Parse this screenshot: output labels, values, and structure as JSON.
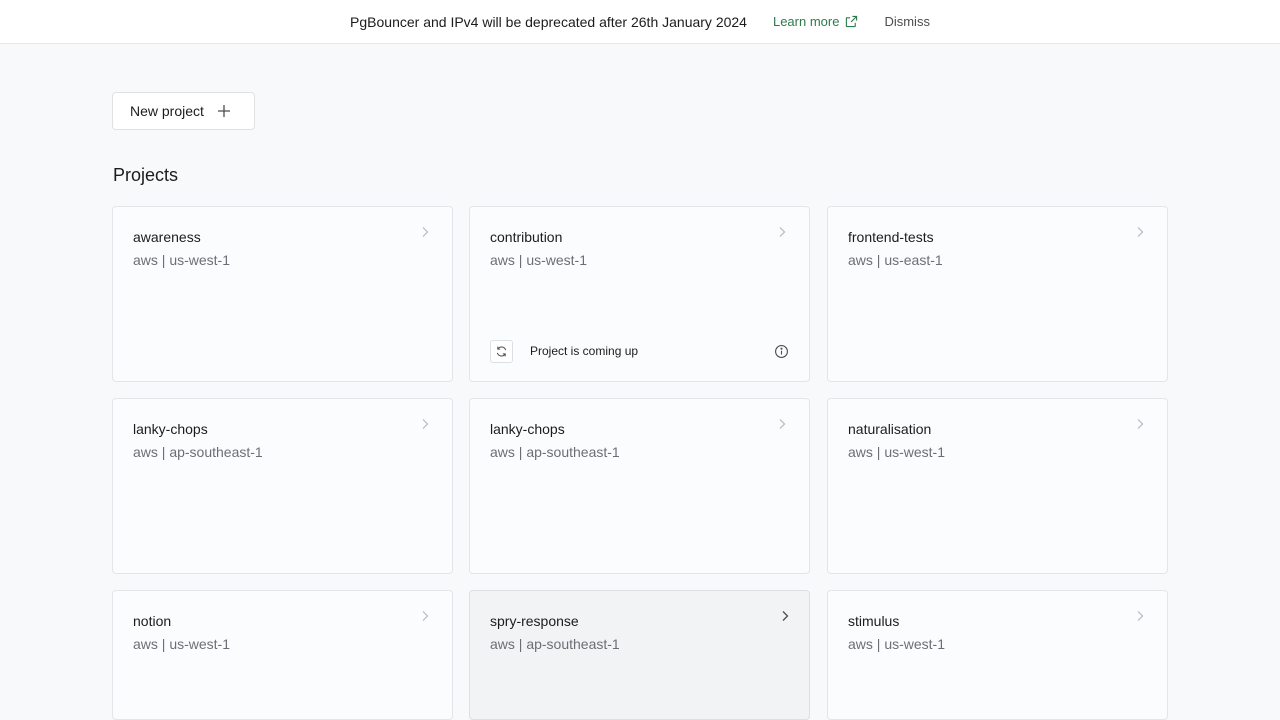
{
  "banner": {
    "message": "PgBouncer and IPv4 will be deprecated after 26th January 2024",
    "learn_more": "Learn more",
    "dismiss": "Dismiss"
  },
  "toolbar": {
    "new_project_label": "New project"
  },
  "projects": {
    "title": "Projects",
    "items": [
      {
        "name": "awareness",
        "meta": "aws | us-west-1"
      },
      {
        "name": "contribution",
        "meta": "aws | us-west-1",
        "status": "Project is coming up"
      },
      {
        "name": "frontend-tests",
        "meta": "aws | us-east-1"
      },
      {
        "name": "lanky-chops",
        "meta": "aws | ap-southeast-1"
      },
      {
        "name": "lanky-chops",
        "meta": "aws | ap-southeast-1"
      },
      {
        "name": "naturalisation",
        "meta": "aws | us-west-1"
      },
      {
        "name": "notion",
        "meta": "aws | us-west-1"
      },
      {
        "name": "spry-response",
        "meta": "aws | ap-southeast-1"
      },
      {
        "name": "stimulus",
        "meta": "aws | us-west-1"
      }
    ]
  },
  "icons": {
    "external": "external-link-icon",
    "plus": "plus-icon",
    "chevron": "chevron-right-icon",
    "refresh": "refresh-icon",
    "info": "info-icon"
  },
  "colors": {
    "accent": "#2f7a4c",
    "background": "#f8f9fa",
    "card": "#fbfcfd"
  }
}
